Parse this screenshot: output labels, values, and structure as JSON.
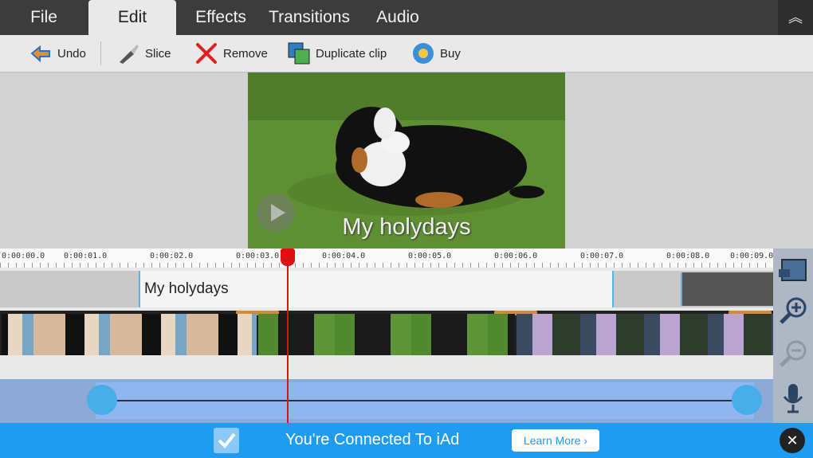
{
  "menu": {
    "tabs": [
      {
        "label": "File"
      },
      {
        "label": "Edit"
      },
      {
        "label": "Effects"
      },
      {
        "label": "Transitions"
      },
      {
        "label": "Audio"
      }
    ],
    "active_tab": "Edit",
    "collapse_icon": "double-chevron-up-icon"
  },
  "toolbar": {
    "undo": {
      "label": "Undo",
      "icon": "undo-icon"
    },
    "slice": {
      "label": "Slice",
      "icon": "knife-icon"
    },
    "remove": {
      "label": "Remove",
      "icon": "red-x-icon"
    },
    "duplicate": {
      "label": "Duplicate clip",
      "icon": "duplicate-film-icon"
    },
    "buy": {
      "label": "Buy",
      "icon": "globe-cart-icon"
    }
  },
  "preview": {
    "caption": "My holydays",
    "image": "dog-on-grass"
  },
  "ruler": {
    "ticks": [
      "0:00:00.0",
      "0:00:01.0",
      "0:00:02.0",
      "0:00:03.0",
      "0:00:04.0",
      "0:00:05.0",
      "0:00:06.0",
      "0:00:07.0",
      "0:00:08.0",
      "0:00:09.0"
    ]
  },
  "timeline": {
    "title_clip": "My holydays",
    "video_clips": [
      "people",
      "dog",
      "waterfall"
    ],
    "playhead_time": "0:00:03.0"
  },
  "side_tools": [
    "voiceover-icon",
    "zoom-in-icon",
    "zoom-out-icon",
    "microphone-icon"
  ],
  "ad": {
    "text": "You're Connected To iAd",
    "button": "Learn More ›",
    "close": "✕"
  },
  "colors": {
    "menubar": "#3c3c3c",
    "playhead": "#e01010",
    "ad_bar": "#1f9bf0",
    "clip_border": "#5ab6e6"
  }
}
